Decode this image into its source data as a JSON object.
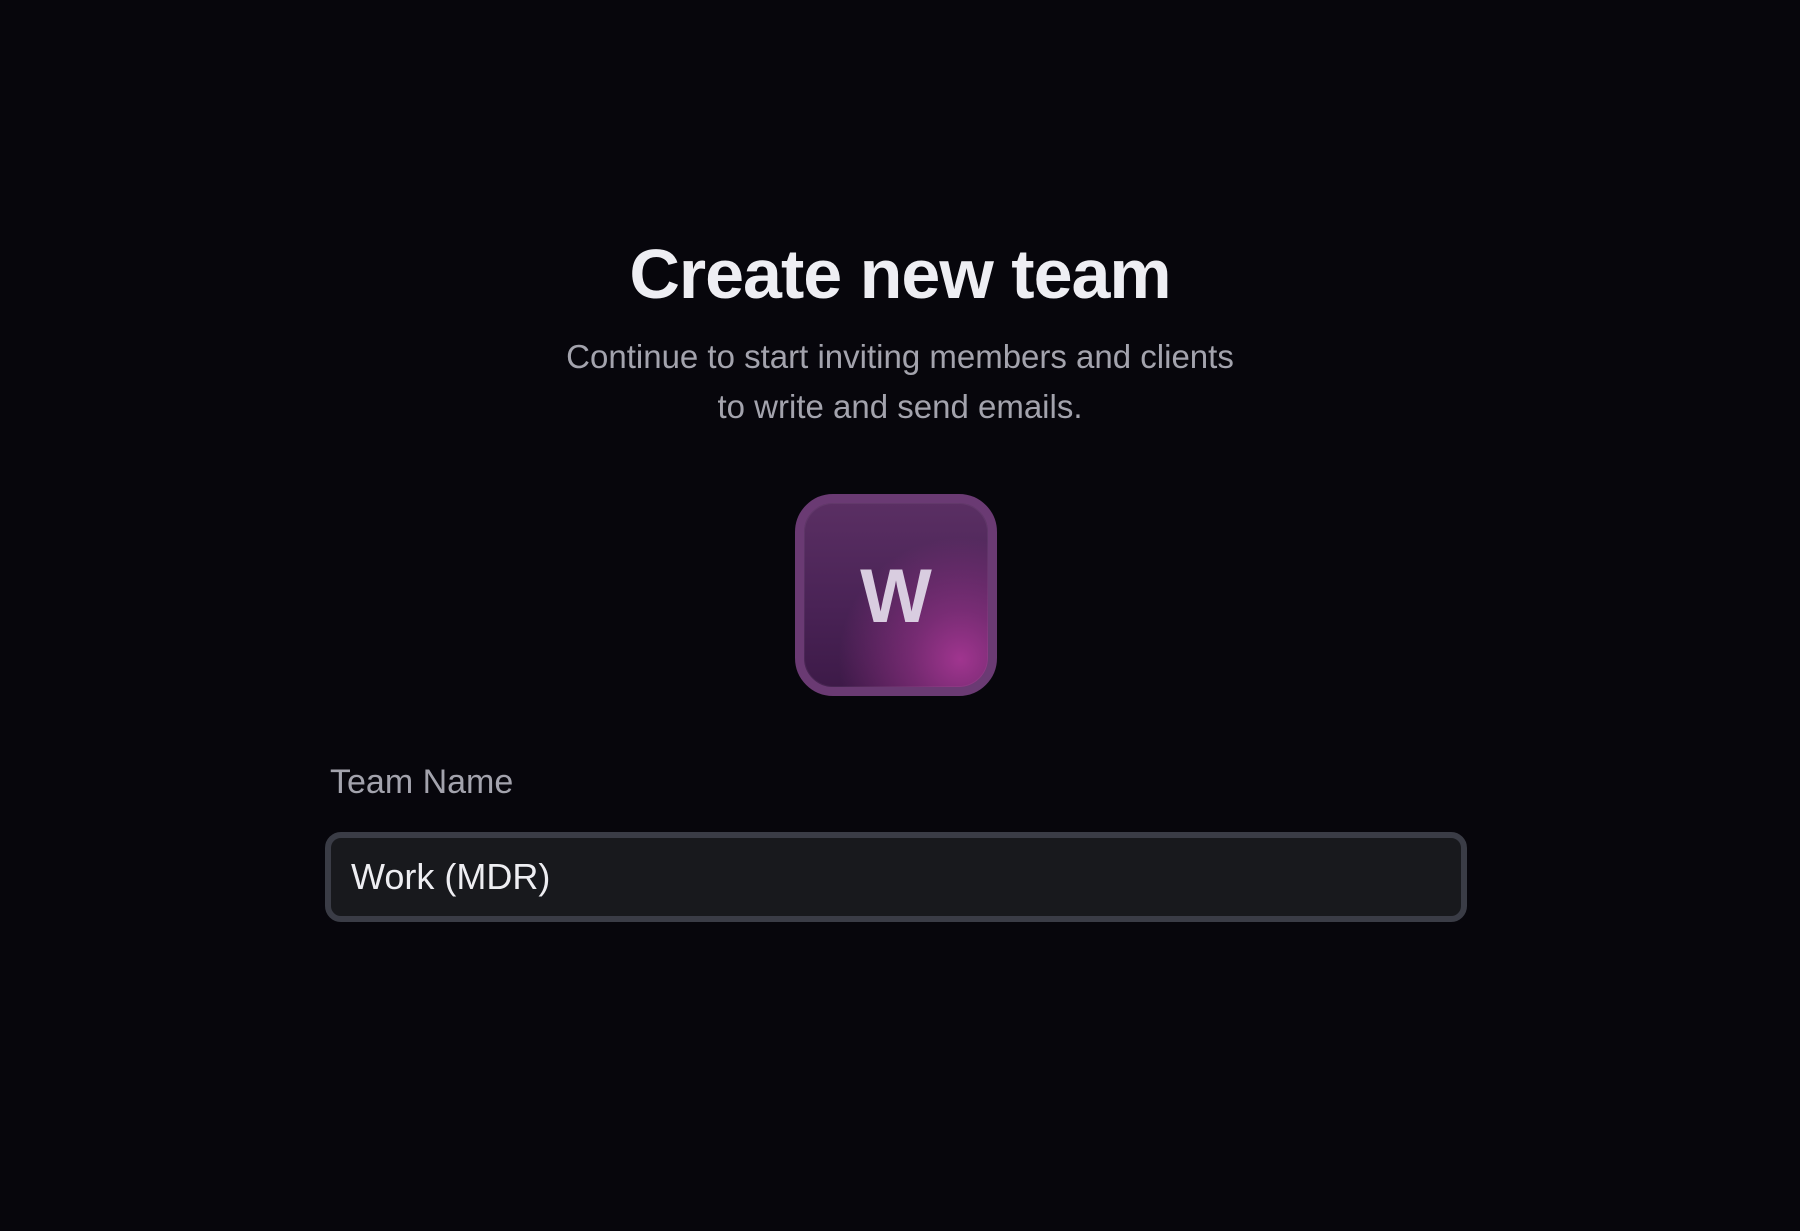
{
  "header": {
    "title": "Create new team",
    "subtitle": "Continue to start inviting members and clients to write and send emails."
  },
  "avatar": {
    "letter": "W",
    "colors": {
      "border": "#6a3a73",
      "fill": "#4a2356",
      "glow": "#a0358f"
    }
  },
  "team_name": {
    "label": "Team Name",
    "value": "Work (MDR)"
  },
  "colors": {
    "background": "#07060c",
    "title": "#eeeef3",
    "muted_text": "#a3a3ad",
    "input_border": "#3a3c46",
    "input_fill": "#18191d"
  }
}
